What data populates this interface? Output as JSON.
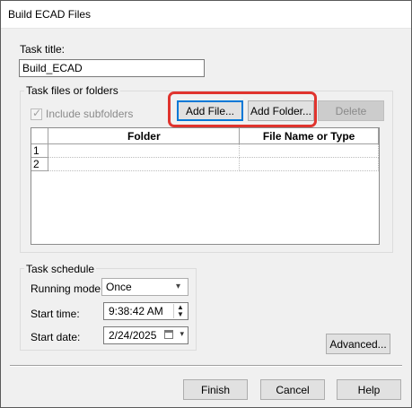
{
  "window": {
    "title": "Build ECAD Files"
  },
  "task_title": {
    "label": "Task title:",
    "value": "Build_ECAD"
  },
  "files_group": {
    "label": "Task files or folders",
    "include_subfolders": {
      "label": "Include subfolders",
      "checked": true,
      "enabled": false
    },
    "buttons": {
      "add_file": "Add File...",
      "add_folder": "Add Folder...",
      "delete": "Delete"
    },
    "table": {
      "columns": [
        "Folder",
        "File Name or Type"
      ],
      "rows": [
        {
          "index": "1",
          "folder": "",
          "file": ""
        },
        {
          "index": "2",
          "folder": "",
          "file": ""
        }
      ]
    }
  },
  "schedule": {
    "label": "Task schedule",
    "running_mode": {
      "label": "Running mode:",
      "value": "Once"
    },
    "start_time": {
      "label": "Start time:",
      "value": "9:38:42 AM"
    },
    "start_date": {
      "label": "Start date:",
      "value": "2/24/2025"
    }
  },
  "advanced_button": "Advanced...",
  "footer": {
    "finish": "Finish",
    "cancel": "Cancel",
    "help": "Help"
  },
  "colors": {
    "highlight": "#e0342e",
    "default_button_border": "#0078d7"
  }
}
